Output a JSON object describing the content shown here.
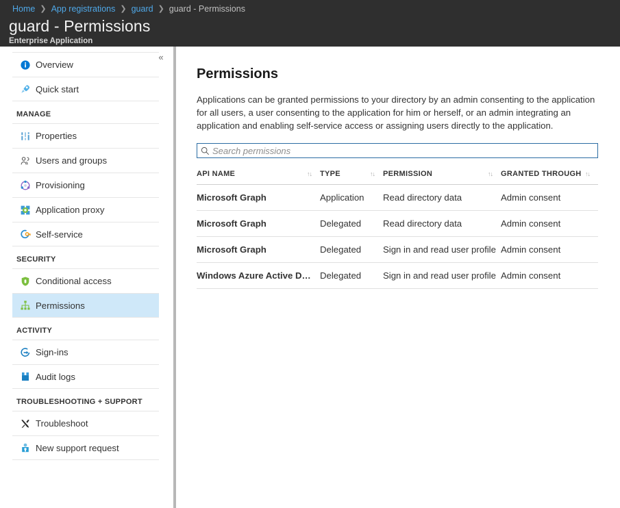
{
  "breadcrumb": {
    "items": [
      {
        "label": "Home",
        "link": true
      },
      {
        "label": "App registrations",
        "link": true
      },
      {
        "label": "guard",
        "link": true
      },
      {
        "label": "guard - Permissions",
        "link": false
      }
    ],
    "separator": "❯"
  },
  "header": {
    "title": "guard - Permissions",
    "subtitle": "Enterprise Application",
    "collapse_icon": "«"
  },
  "sidebar": {
    "top_items": [
      {
        "label": "Overview",
        "icon": "info-circle-icon"
      },
      {
        "label": "Quick start",
        "icon": "rocket-icon"
      }
    ],
    "groups": [
      {
        "title": "MANAGE",
        "items": [
          {
            "label": "Properties",
            "icon": "sliders-icon"
          },
          {
            "label": "Users and groups",
            "icon": "users-icon"
          },
          {
            "label": "Provisioning",
            "icon": "provisioning-icon"
          },
          {
            "label": "Application proxy",
            "icon": "app-proxy-icon"
          },
          {
            "label": "Self-service",
            "icon": "self-service-icon"
          }
        ]
      },
      {
        "title": "SECURITY",
        "items": [
          {
            "label": "Conditional access",
            "icon": "shield-icon"
          },
          {
            "label": "Permissions",
            "icon": "hierarchy-icon",
            "selected": true
          }
        ]
      },
      {
        "title": "ACTIVITY",
        "items": [
          {
            "label": "Sign-ins",
            "icon": "sign-in-arrow-icon"
          },
          {
            "label": "Audit logs",
            "icon": "book-icon"
          }
        ]
      },
      {
        "title": "TROUBLESHOOTING + SUPPORT",
        "items": [
          {
            "label": "Troubleshoot",
            "icon": "wrench-screwdriver-icon"
          },
          {
            "label": "New support request",
            "icon": "support-agent-icon"
          }
        ]
      }
    ]
  },
  "main": {
    "heading": "Permissions",
    "description": "Applications can be granted permissions to your directory by an admin consenting to the application for all users, a user consenting to the application for him or herself, or an admin integrating an application and enabling self-service access or assigning users directly to the application.",
    "search": {
      "placeholder": "Search permissions",
      "value": "",
      "icon": "search-icon"
    },
    "table": {
      "sort_icon": "↑↓",
      "columns": [
        {
          "label": "API NAME",
          "sortable": true
        },
        {
          "label": "TYPE",
          "sortable": true
        },
        {
          "label": "PERMISSION",
          "sortable": true
        },
        {
          "label": "GRANTED THROUGH",
          "sortable": true
        }
      ],
      "rows": [
        {
          "api_name": "Microsoft Graph",
          "type": "Application",
          "permission": "Read directory data",
          "granted_through": "Admin consent"
        },
        {
          "api_name": "Microsoft Graph",
          "type": "Delegated",
          "permission": "Read directory data",
          "granted_through": "Admin consent"
        },
        {
          "api_name": "Microsoft Graph",
          "type": "Delegated",
          "permission": "Sign in and read user profile",
          "granted_through": "Admin consent"
        },
        {
          "api_name": "Windows Azure Active Direct…",
          "type": "Delegated",
          "permission": "Sign in and read user profile",
          "granted_through": "Admin consent"
        }
      ]
    }
  },
  "colors": {
    "chrome_dark": "#2f2f2f",
    "link_blue": "#4fa8e8",
    "selected_nav": "#cfe8f9",
    "search_border": "#2b6ca3"
  }
}
